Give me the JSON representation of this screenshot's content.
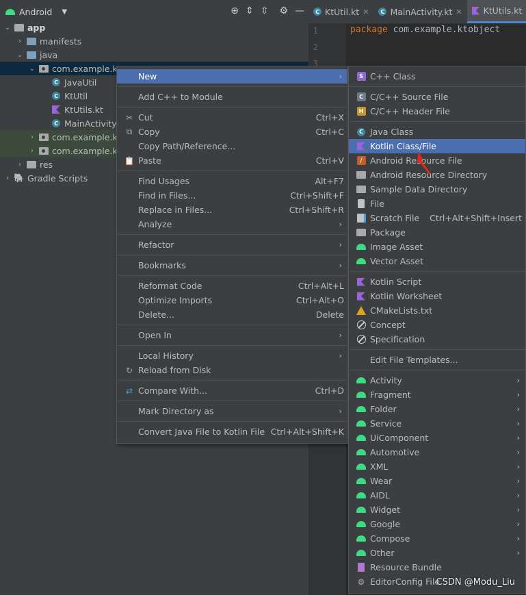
{
  "project_panel": {
    "view_label": "Android",
    "tree": [
      {
        "label": "app",
        "bold": true
      },
      {
        "label": "manifests"
      },
      {
        "label": "java"
      },
      {
        "label": "com.example.kt"
      },
      {
        "label": "JavaUtil"
      },
      {
        "label": "KtUtil"
      },
      {
        "label": "KtUtils.kt"
      },
      {
        "label": "MainActivity"
      },
      {
        "label": "com.example.kt"
      },
      {
        "label": "com.example.kt"
      },
      {
        "label": "res"
      },
      {
        "label": "Gradle Scripts"
      }
    ]
  },
  "editor": {
    "tabs": [
      {
        "label": "KtUtil.kt",
        "active": false
      },
      {
        "label": "MainActivity.kt",
        "active": false
      },
      {
        "label": "KtUtils.kt",
        "active": true
      }
    ],
    "line_numbers": [
      "1",
      "2",
      "3"
    ],
    "code_keyword": "package",
    "code_rest": "com.example.ktobject"
  },
  "context_menu": {
    "items": [
      {
        "label": "New",
        "submenu": true,
        "highlighted": true
      },
      {
        "label": "Add C++ to Module"
      },
      {
        "label": "Cut",
        "shortcut": "Ctrl+X",
        "icon": "scissors-icon"
      },
      {
        "label": "Copy",
        "shortcut": "Ctrl+C",
        "icon": "copy-icon"
      },
      {
        "label": "Copy Path/Reference..."
      },
      {
        "label": "Paste",
        "shortcut": "Ctrl+V",
        "icon": "clipboard-icon"
      },
      {
        "label": "Find Usages",
        "shortcut": "Alt+F7"
      },
      {
        "label": "Find in Files...",
        "shortcut": "Ctrl+Shift+F"
      },
      {
        "label": "Replace in Files...",
        "shortcut": "Ctrl+Shift+R"
      },
      {
        "label": "Analyze",
        "submenu": true
      },
      {
        "label": "Refactor",
        "submenu": true
      },
      {
        "label": "Bookmarks",
        "submenu": true
      },
      {
        "label": "Reformat Code",
        "shortcut": "Ctrl+Alt+L"
      },
      {
        "label": "Optimize Imports",
        "shortcut": "Ctrl+Alt+O"
      },
      {
        "label": "Delete...",
        "shortcut": "Delete"
      },
      {
        "label": "Open In",
        "submenu": true
      },
      {
        "label": "Local History",
        "submenu": true
      },
      {
        "label": "Reload from Disk",
        "icon": "reload-icon"
      },
      {
        "label": "Compare With...",
        "shortcut": "Ctrl+D",
        "icon": "compare-icon"
      },
      {
        "label": "Mark Directory as",
        "submenu": true
      },
      {
        "label": "Convert Java File to Kotlin File",
        "shortcut": "Ctrl+Alt+Shift+K"
      }
    ]
  },
  "new_submenu": {
    "items": [
      {
        "label": "C++ Class"
      },
      {
        "label": "C/C++ Source File"
      },
      {
        "label": "C/C++ Header File"
      },
      {
        "label": "Java Class"
      },
      {
        "label": "Kotlin Class/File",
        "highlighted": true
      },
      {
        "label": "Android Resource File"
      },
      {
        "label": "Android Resource Directory"
      },
      {
        "label": "Sample Data Directory"
      },
      {
        "label": "File"
      },
      {
        "label": "Scratch File",
        "shortcut": "Ctrl+Alt+Shift+Insert"
      },
      {
        "label": "Package"
      },
      {
        "label": "Image Asset"
      },
      {
        "label": "Vector Asset"
      },
      {
        "label": "Kotlin Script"
      },
      {
        "label": "Kotlin Worksheet"
      },
      {
        "label": "CMakeLists.txt"
      },
      {
        "label": "Concept"
      },
      {
        "label": "Specification"
      },
      {
        "label": "Edit File Templates..."
      },
      {
        "label": "Activity",
        "submenu": true
      },
      {
        "label": "Fragment",
        "submenu": true
      },
      {
        "label": "Folder",
        "submenu": true
      },
      {
        "label": "Service",
        "submenu": true
      },
      {
        "label": "UiComponent",
        "submenu": true
      },
      {
        "label": "Automotive",
        "submenu": true
      },
      {
        "label": "XML",
        "submenu": true
      },
      {
        "label": "Wear",
        "submenu": true
      },
      {
        "label": "AIDL",
        "submenu": true
      },
      {
        "label": "Widget",
        "submenu": true
      },
      {
        "label": "Google",
        "submenu": true
      },
      {
        "label": "Compose",
        "submenu": true
      },
      {
        "label": "Other",
        "submenu": true
      },
      {
        "label": "Resource Bundle"
      },
      {
        "label": "EditorConfig File"
      }
    ]
  },
  "watermark": "CSDN @Modu_Liu",
  "colors": {
    "highlight": "#4b6eaf",
    "panel": "#3c3f41",
    "editor_bg": "#2b2b2b",
    "android_green": "#3ddc84",
    "annotation_red": "#e8261c"
  }
}
